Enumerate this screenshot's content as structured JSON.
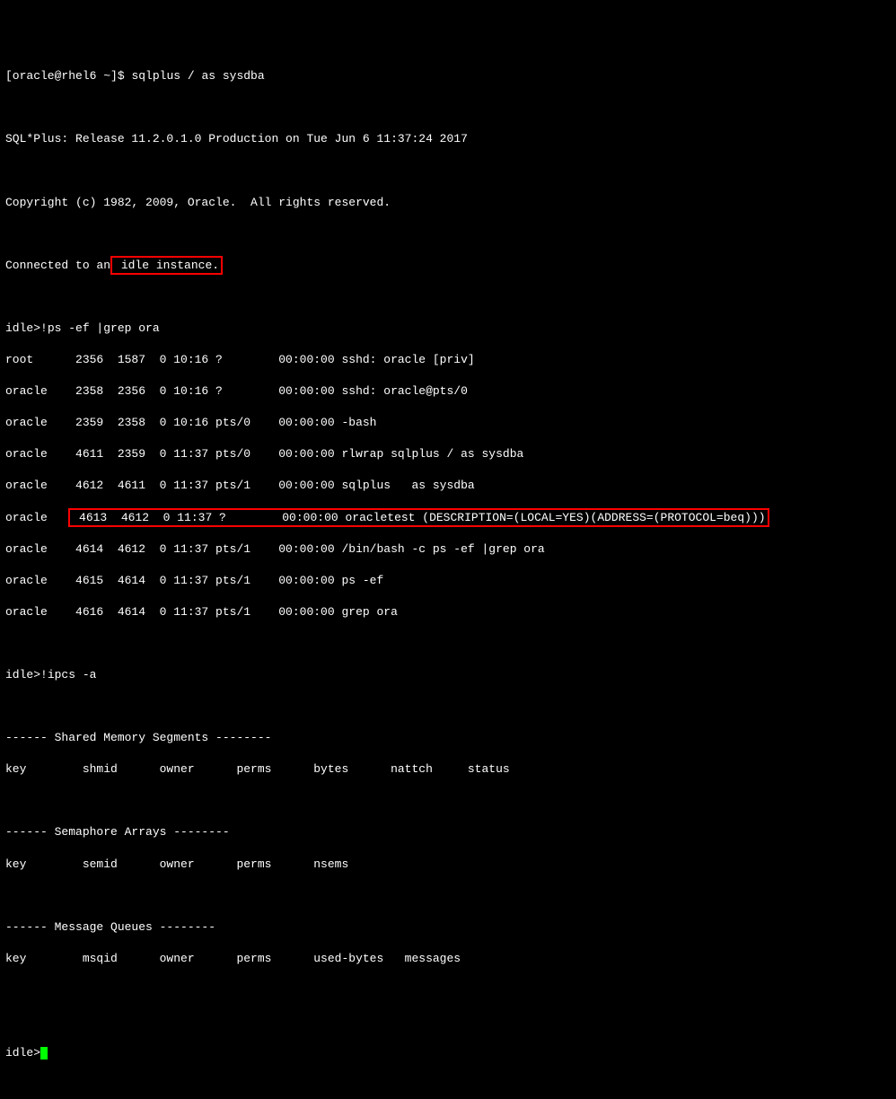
{
  "prompt1": "[oracle@rhel6 ~]$ ",
  "cmd1": "sqlplus / as sysdba",
  "banner1": "SQL*Plus: Release 11.2.0.1.0 Production on Tue Jun 6 11:37:24 2017",
  "copyright": "Copyright (c) 1982, 2009, Oracle.  All rights reserved.",
  "connected_prefix": "Connected to an",
  "connected_highlight": " idle instance.",
  "idle_prompt1": "idle>",
  "idle_cmd1": "!ps -ef |grep ora",
  "ps_rows": [
    "root      2356  1587  0 10:16 ?        00:00:00 sshd: oracle [priv]",
    "oracle    2358  2356  0 10:16 ?        00:00:00 sshd: oracle@pts/0",
    "oracle    2359  2358  0 10:16 pts/0    00:00:00 -bash",
    "oracle    4611  2359  0 11:37 pts/0    00:00:00 rlwrap sqlplus / as sysdba",
    "oracle    4612  4611  0 11:37 pts/1    00:00:00 sqlplus   as sysdba"
  ],
  "ps_highlight_prefix": "oracle   ",
  "ps_highlight": " 4613  4612  0 11:37 ?        00:00:00 oracletest (DESCRIPTION=(LOCAL=YES)(ADDRESS=(PROTOCOL=beq)))",
  "ps_rows2": [
    "oracle    4614  4612  0 11:37 pts/1    00:00:00 /bin/bash -c ps -ef |grep ora",
    "oracle    4615  4614  0 11:37 pts/1    00:00:00 ps -ef",
    "oracle    4616  4614  0 11:37 pts/1    00:00:00 grep ora"
  ],
  "idle_prompt2": "idle>",
  "idle_cmd2": "!ipcs -a",
  "shm_header": "------ Shared Memory Segments --------",
  "shm_cols": "key        shmid      owner      perms      bytes      nattch     status",
  "sem_header": "------ Semaphore Arrays --------",
  "sem_cols": "key        semid      owner      perms      nsems",
  "msg_header": "------ Message Queues --------",
  "msg_cols": "key        msqid      owner      perms      used-bytes   messages",
  "idle_prompt3": "idle>"
}
